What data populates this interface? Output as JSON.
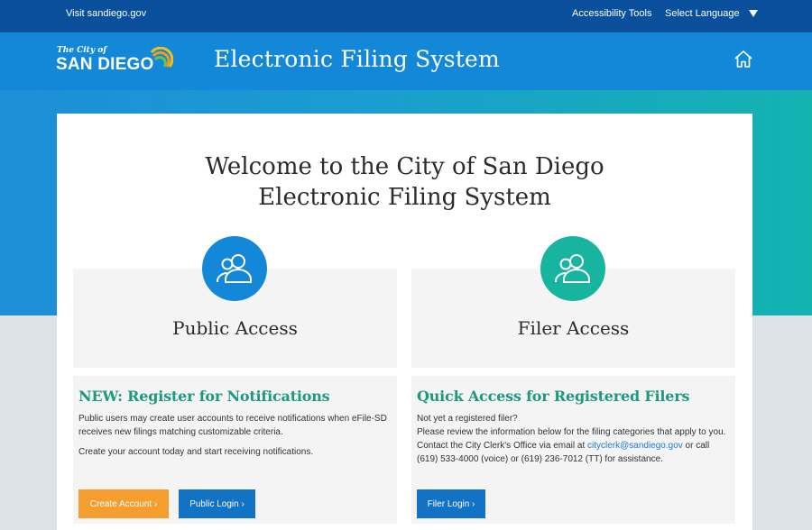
{
  "topbar": {
    "visit_link": "Visit sandiego.gov",
    "accessibility_link": "Accessibility Tools",
    "language_select": "Select Language"
  },
  "header": {
    "logo_small": "The City of",
    "logo_big": "SAN DIEGO",
    "title": "Electronic Filing System",
    "home_icon": "home-icon"
  },
  "welcome": {
    "line1": "Welcome to the City of San Diego",
    "line2": "Electronic Filing System"
  },
  "public_access": {
    "title": "Public Access",
    "icon": "users-icon",
    "heading": "NEW: Register for Notifications",
    "para1": "Public users may create user accounts to receive notifications when eFile-SD receives new filings matching customizable criteria.",
    "para2": "Create your account today and start receiving notifications.",
    "create_button": "Create Account ›",
    "login_button": "Public Login ›"
  },
  "filer_access": {
    "title": "Filer Access",
    "icon": "users-icon",
    "heading": "Quick Access for Registered Filers",
    "line1": "Not yet a registered filer?",
    "line2": "Please review the information below for the filing categories that apply to you.",
    "contact_prefix": "Contact the City Clerk's Office via email at ",
    "email": "cityclerk@sandiego.gov",
    "contact_suffix": " or call (619) 533-4000 (voice) or (619) 236-7012 (TT) for assistance.",
    "login_button": "Filer Login ›"
  },
  "colors": {
    "topbar": "#0a4f9c",
    "header": "#1488d8",
    "teal": "#17b5a0",
    "heading_green": "#1b9a7d",
    "orange": "#f59e2f",
    "button_blue": "#1272c4"
  }
}
